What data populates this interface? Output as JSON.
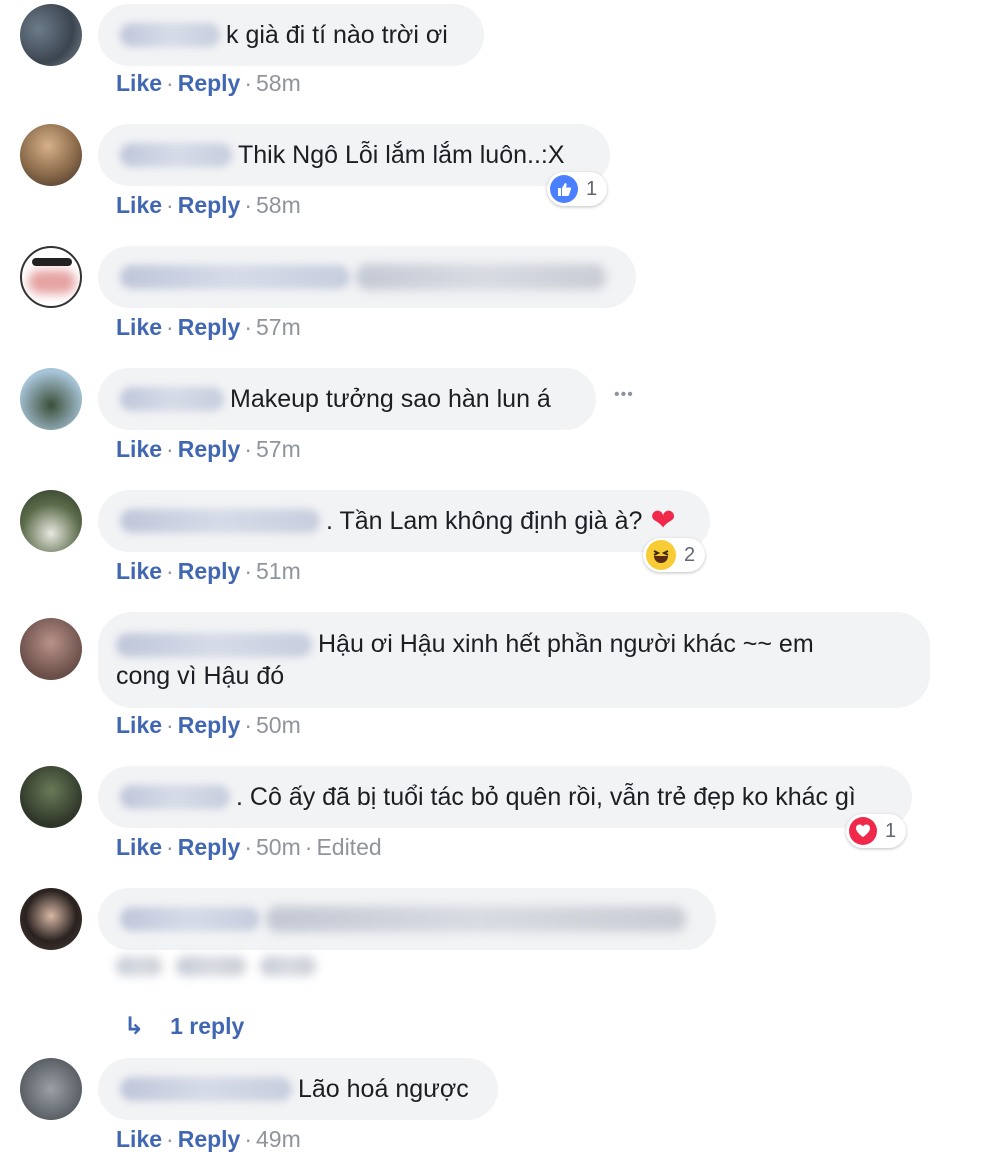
{
  "actions": {
    "like": "Like",
    "reply": "Reply",
    "edited": "Edited",
    "sep": "·"
  },
  "comments": [
    {
      "text": "k già đi tí nào trời ơi",
      "time": "58m"
    },
    {
      "text": "Thik Ngô Lỗi lắm lắm luôn..:X",
      "time": "58m",
      "reaction": {
        "type": "like",
        "count": "1"
      }
    },
    {
      "text": "",
      "time": "57m"
    },
    {
      "text": "Makeup tưởng sao hàn lun á",
      "time": "57m",
      "more": "•••"
    },
    {
      "text": ". Tần Lam không định già à?",
      "emoji": "❤",
      "time": "51m",
      "reaction": {
        "type": "haha",
        "count": "2"
      }
    },
    {
      "text_line1": "Hậu ơi Hậu xinh hết phần người khác ~~ em",
      "text_line2": "cong vì Hậu đó",
      "time": "50m"
    },
    {
      "text": ". Cô ấy đã bị tuổi tác bỏ quên rồi, vẫn trẻ đẹp ko khác gì",
      "time": "50m",
      "edited": true,
      "reaction": {
        "type": "love",
        "count": "1"
      }
    },
    {
      "text": "",
      "time": "",
      "reply_count": "1 reply"
    },
    {
      "text": "Lão hoá ngược",
      "time": "49m"
    }
  ],
  "colors": {
    "link": "#4267b2",
    "meta": "#90949c",
    "bubble": "#f2f3f5",
    "like_blue": "#4a7fff",
    "love_red": "#f0284a",
    "haha_yellow": "#f7cc35"
  }
}
